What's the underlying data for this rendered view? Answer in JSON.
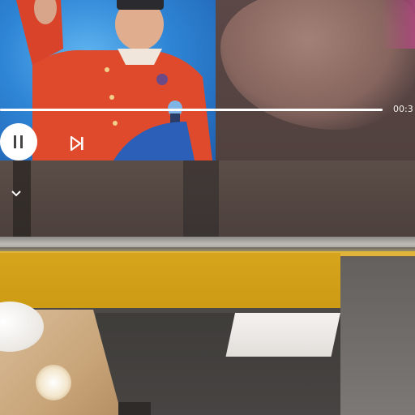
{
  "player": {
    "time_text": "00:3",
    "progress_fraction": 1.0
  },
  "icons": {
    "pause": "pause-icon",
    "next": "skip-next-icon",
    "collapse": "chevron-down-icon"
  },
  "colors": {
    "video_sky": "#2f86d6",
    "jacket": "#e04a2c",
    "shelf_yellow": "#d7a51c",
    "control_white": "#ffffff"
  }
}
